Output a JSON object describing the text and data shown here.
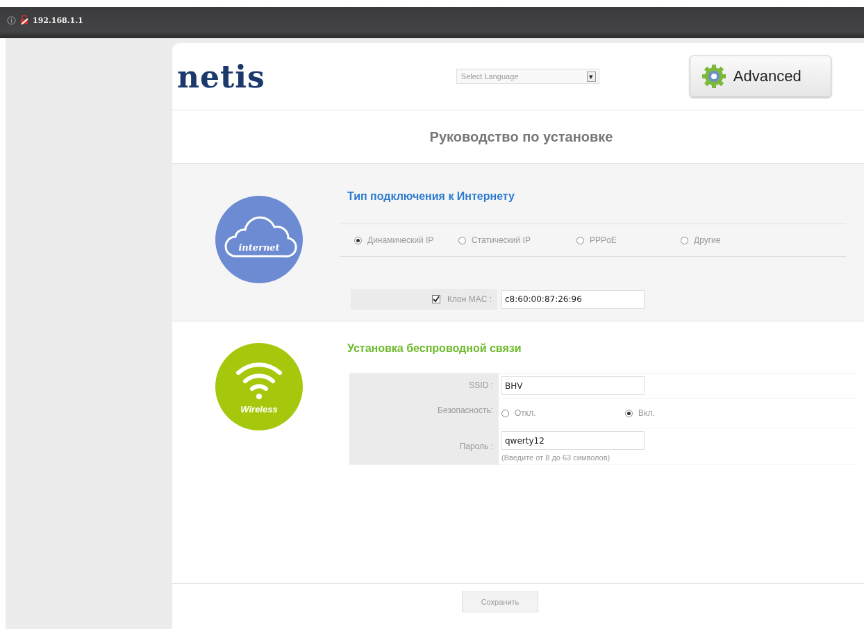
{
  "browser": {
    "address": "192.168.1.1"
  },
  "header": {
    "logo": "netis",
    "language_select": {
      "value": "Select Language",
      "arrow": "▾"
    },
    "advanced_button": "Advanced"
  },
  "title": "Руководство по установке",
  "internet": {
    "icon_label": "internet",
    "heading": "Тип подключения к Интернету",
    "connection_types": [
      {
        "label": "Динамический IP",
        "selected": true
      },
      {
        "label": "Статический IP",
        "selected": false
      },
      {
        "label": "PPPoE",
        "selected": false
      },
      {
        "label": "Другие",
        "selected": false
      }
    ],
    "mac_clone": {
      "label": "Клон MAC :",
      "checked": true,
      "value": "c8:60:00:87:26:96"
    }
  },
  "wireless": {
    "icon_label": "Wireless",
    "heading": "Установка беспроводной связи",
    "rows": [
      {
        "kind": "text",
        "label": "SSID :",
        "value": "BHV"
      },
      {
        "kind": "radio",
        "label": "Безопасность:",
        "options": [
          {
            "label": "Откл.",
            "selected": false
          },
          {
            "label": "Вкл.",
            "selected": true
          }
        ]
      },
      {
        "kind": "password",
        "label": "Пароль :",
        "value": "qwerty12",
        "hint": "(Введите от 8 до 63 символов)"
      }
    ]
  },
  "save_button": "Сохранить"
}
